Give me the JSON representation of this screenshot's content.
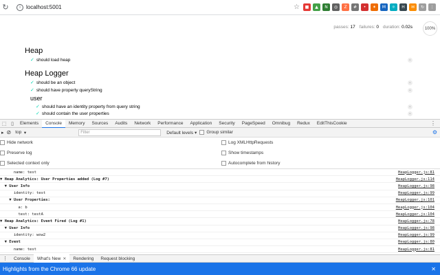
{
  "browser": {
    "url": "localhost:5001",
    "extensions": [
      {
        "name": "blocker-icon",
        "color": "#e53935",
        "glyph": "■"
      },
      {
        "name": "shield-icon",
        "color": "#43a047",
        "glyph": "▲"
      },
      {
        "name": "new-badge-icon",
        "color": "#2e7d32",
        "glyph": "N"
      },
      {
        "name": "camera-icon",
        "color": "#616161",
        "glyph": "◎"
      },
      {
        "name": "zoom-icon",
        "color": "#ff7043",
        "glyph": "Z"
      },
      {
        "name": "grid-icon",
        "color": "#757575",
        "glyph": "#"
      },
      {
        "name": "lastpass-icon",
        "color": "#d32f2f",
        "glyph": "•"
      },
      {
        "name": "hotjar-icon",
        "color": "#ef6c00",
        "glyph": "✶"
      },
      {
        "name": "monitor-icon",
        "color": "#1565c0",
        "glyph": "M"
      },
      {
        "name": "react-icon",
        "color": "#00acc1",
        "glyph": "⚛"
      },
      {
        "name": "h-icon",
        "color": "#37474f",
        "glyph": "H"
      },
      {
        "name": "mail-icon",
        "color": "#fb8c00",
        "glyph": "✉"
      },
      {
        "name": "sync-icon",
        "color": "#9e9e9e",
        "glyph": "↻"
      },
      {
        "name": "menu-icon",
        "color": "#9e9e9e",
        "glyph": "⋮"
      }
    ]
  },
  "mocha": {
    "passes_label": "passes:",
    "passes": "17",
    "failures_label": "failures:",
    "failures": "0",
    "duration_label": "duration:",
    "duration": "0.02s",
    "progress": "100%",
    "suites": [
      {
        "title": "Heap",
        "tests": [
          "should load heap"
        ]
      },
      {
        "title": "Heap Logger",
        "tests": [
          "should be an object",
          "should have property queryString"
        ]
      },
      {
        "title": "user",
        "tests": [
          "should have an identity property from query string",
          "should contain the user properties"
        ]
      }
    ]
  },
  "devtools": {
    "tabs": [
      "Elements",
      "Console",
      "Memory",
      "Sources",
      "Audits",
      "Network",
      "Performance",
      "Application",
      "Security",
      "PageSpeed",
      "Omnibug",
      "Redux",
      "EditThisCookie"
    ],
    "active_tab": "Console",
    "context": "top",
    "filter_placeholder": "Filter",
    "levels": "Default levels ▾",
    "group_similar": "Group similar",
    "settings": {
      "hide_network": "Hide network",
      "preserve_log": "Preserve log",
      "selected_context": "Selected context only",
      "log_xhr": "Log XMLHttpRequests",
      "show_timestamps": "Show timestamps",
      "autocomplete": "Autocomplete from history"
    },
    "console_rows": [
      {
        "text": "      name: test",
        "src": "HeapLogger.js:81",
        "bold": false
      },
      {
        "text": "▼ Heap Analytics: User Properties added (Log #7)",
        "src": "HeapLogger.js:114",
        "bold": true
      },
      {
        "text": "  ▼ User Info",
        "src": "HeapLogger.js:98",
        "bold": true
      },
      {
        "text": "      identity: test",
        "src": "HeapLogger.js:99",
        "bold": false
      },
      {
        "text": "    ▼ User Properties:",
        "src": "HeapLogger.js:101",
        "bold": true
      },
      {
        "text": "        a: b",
        "src": "HeapLogger.js:104",
        "bold": false
      },
      {
        "text": "        test: testA",
        "src": "HeapLogger.js:104",
        "bold": false
      },
      {
        "text": "▼ Heap Analytics: Event Fired (Log #1)",
        "src": "HeapLogger.js:78",
        "bold": true
      },
      {
        "text": "  ▼ User Info",
        "src": "HeapLogger.js:98",
        "bold": true
      },
      {
        "text": "      identity: wow2",
        "src": "HeapLogger.js:99",
        "bold": false
      },
      {
        "text": "  ▼ Event",
        "src": "HeapLogger.js:80",
        "bold": true
      },
      {
        "text": "      name: test",
        "src": "HeapLogger.js:81",
        "bold": false
      }
    ],
    "drawer_tabs": [
      "Console",
      "What's New",
      "Rendering",
      "Request blocking"
    ],
    "banner": "Highlights from the Chrome 66 update"
  }
}
